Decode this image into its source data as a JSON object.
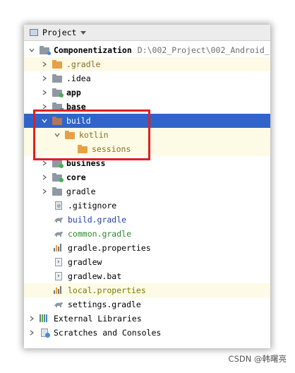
{
  "panel": {
    "title": "Project"
  },
  "tree": [
    {
      "label": "Componentization",
      "path": "D:\\002_Project\\002_Android_",
      "icon": "module-folder-icon"
    },
    {
      "label": ".gradle",
      "icon": "folder-icon"
    },
    {
      "label": ".idea",
      "icon": "folder-icon"
    },
    {
      "label": "app",
      "icon": "module-folder-icon"
    },
    {
      "label": "base",
      "icon": "module-folder-icon"
    },
    {
      "label": "build",
      "icon": "folder-icon"
    },
    {
      "label": "kotlin",
      "icon": "folder-icon"
    },
    {
      "label": "sessions",
      "icon": "folder-icon"
    },
    {
      "label": "business",
      "icon": "module-folder-icon"
    },
    {
      "label": "core",
      "icon": "module-folder-icon"
    },
    {
      "label": "gradle",
      "icon": "folder-icon"
    },
    {
      "label": ".gitignore",
      "icon": "gitignore-file-icon"
    },
    {
      "label": "build.gradle",
      "icon": "gradle-file-icon"
    },
    {
      "label": "common.gradle",
      "icon": "gradle-file-icon"
    },
    {
      "label": "gradle.properties",
      "icon": "properties-file-icon"
    },
    {
      "label": "gradlew",
      "icon": "shell-file-icon"
    },
    {
      "label": "gradlew.bat",
      "icon": "bat-file-icon"
    },
    {
      "label": "local.properties",
      "icon": "properties-file-icon"
    },
    {
      "label": "settings.gradle",
      "icon": "gradle-file-icon"
    },
    {
      "label": "External Libraries",
      "icon": "libraries-icon"
    },
    {
      "label": "Scratches and Consoles",
      "icon": "scratches-icon"
    }
  ],
  "colors": {
    "selection": "#2f65ca",
    "highlight_box": "#e0201f",
    "folder_orange": "#e8a045"
  },
  "watermark": "CSDN @韩曙亮"
}
